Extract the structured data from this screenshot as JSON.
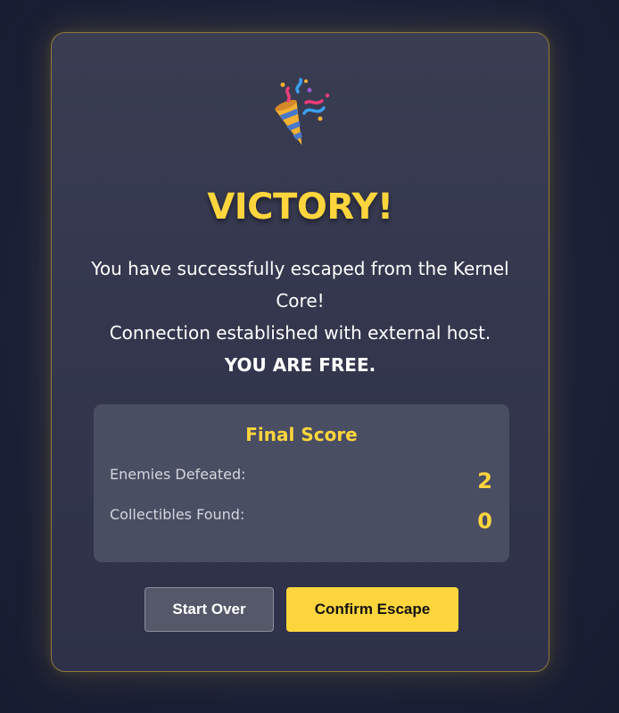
{
  "dialog": {
    "title": "VICTORY!",
    "message_line1": "You have successfully escaped from the Kernel Core!",
    "message_line2": "Connection established with external host.",
    "message_line3": "YOU ARE FREE.",
    "icon": "party-popper-icon"
  },
  "score": {
    "title": "Final Score",
    "rows": [
      {
        "label": "Enemies Defeated:",
        "value": "2"
      },
      {
        "label": "Collectibles Found:",
        "value": "0"
      }
    ]
  },
  "buttons": {
    "start_over": "Start Over",
    "confirm_escape": "Confirm Escape"
  },
  "colors": {
    "accent": "#ffd53d",
    "background": "#1c2139",
    "panel": "#33364d",
    "score_box": "#4a4e63"
  }
}
